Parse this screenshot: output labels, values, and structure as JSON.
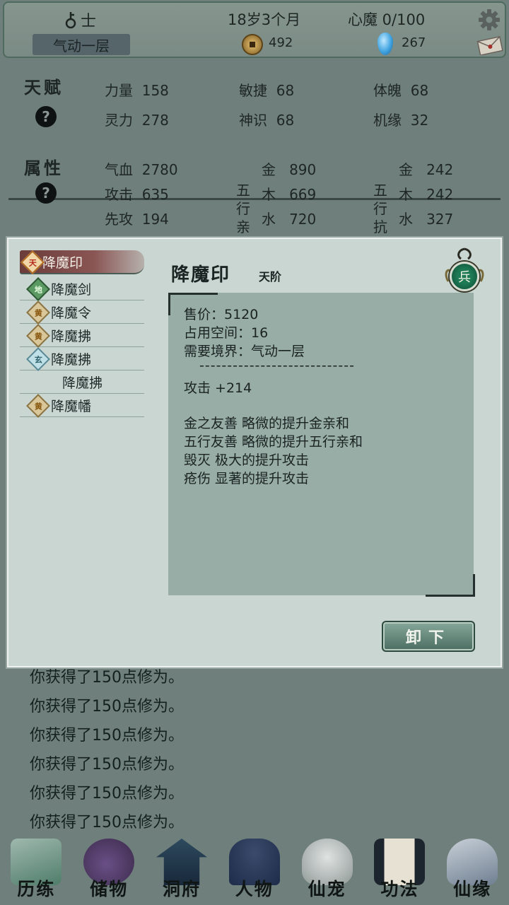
{
  "header": {
    "rank": "士",
    "age": "18岁3个月",
    "heart_demon": "心魔 0/100",
    "realm": "气动一层",
    "coins": "492",
    "gems": "267"
  },
  "talent": {
    "title": "天赋",
    "help": "?",
    "stats": [
      {
        "label": "力量",
        "value": "158"
      },
      {
        "label": "敏捷",
        "value": "68"
      },
      {
        "label": "体魄",
        "value": "68"
      },
      {
        "label": "灵力",
        "value": "278"
      },
      {
        "label": "神识",
        "value": "68"
      },
      {
        "label": "机缘",
        "value": "32"
      }
    ]
  },
  "attributes": {
    "title": "属性",
    "help": "?",
    "base": [
      {
        "label": "气血",
        "value": "2780"
      },
      {
        "label": "攻击",
        "value": "635"
      },
      {
        "label": "先攻",
        "value": "194"
      }
    ],
    "affinity_label": "五行亲",
    "affinity": [
      {
        "label": "金",
        "value": "890"
      },
      {
        "label": "木",
        "value": "669"
      },
      {
        "label": "水",
        "value": "720"
      }
    ],
    "resist_label": "五行抗",
    "resist": [
      {
        "label": "金",
        "value": "242"
      },
      {
        "label": "木",
        "value": "242"
      },
      {
        "label": "水",
        "value": "327"
      }
    ]
  },
  "modal": {
    "list": [
      {
        "grade": "天",
        "name": "降魔印",
        "selected": true
      },
      {
        "grade": "地",
        "name": "降魔剑"
      },
      {
        "grade": "黄",
        "name": "降魔令"
      },
      {
        "grade": "黄",
        "name": "降魔拂"
      },
      {
        "grade": "玄",
        "name": "降魔拂"
      },
      {
        "grade": "",
        "name": "降魔拂"
      },
      {
        "grade": "黄",
        "name": "降魔幡"
      }
    ],
    "title": "降魔印",
    "tier": "天阶",
    "slot": "兵",
    "price": "售价：5120",
    "space": "占用空间：16",
    "requirement": "需要境界：气动一层",
    "separator": "----------------------------",
    "attack": "攻击 +214",
    "effects": [
      "金之友善 略微的提升金亲和",
      "五行友善 略微的提升五行亲和",
      "毁灭 极大的提升攻击",
      "疮伤 显著的提升攻击"
    ],
    "unequip": "卸下"
  },
  "log": [
    "你获得了150点修为。",
    "你获得了150点修为。",
    "你获得了150点修为。",
    "你获得了150点修为。",
    "你获得了150点修为。",
    "你获得了150点修为。"
  ],
  "nav": [
    {
      "label": "历练",
      "color": "#4f7d6a"
    },
    {
      "label": "储物",
      "color": "#55406a"
    },
    {
      "label": "洞府",
      "color": "#22384a"
    },
    {
      "label": "人物",
      "color": "#1e2c4a"
    },
    {
      "label": "仙宠",
      "color": "#a8b0ae"
    },
    {
      "label": "功法",
      "color": "#2a3340"
    },
    {
      "label": "仙缘",
      "color": "#8795a5"
    }
  ]
}
